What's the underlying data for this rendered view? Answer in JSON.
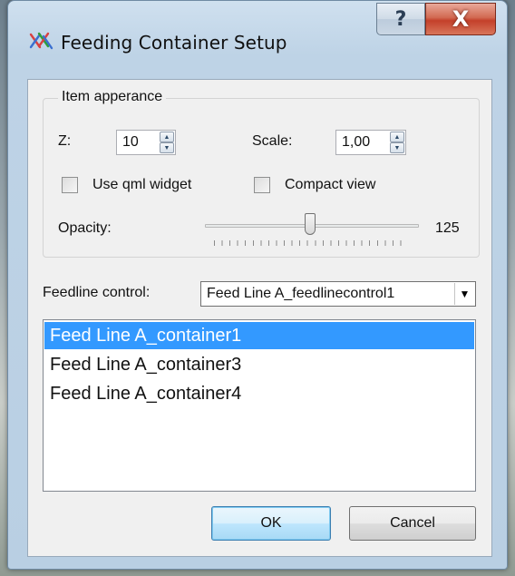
{
  "window": {
    "title": "Feeding Container Setup",
    "app_icon": "app-icon",
    "help_label": "?",
    "close_label": "X"
  },
  "item_appearance": {
    "group_title": "Item apperance",
    "z_label": "Z:",
    "z_value": "10",
    "scale_label": "Scale:",
    "scale_value": "1,00",
    "use_qml_label": "Use qml widget",
    "use_qml_checked": false,
    "compact_view_label": "Compact view",
    "compact_view_checked": false,
    "opacity_label": "Opacity:",
    "opacity_value": "125",
    "opacity_max": 255
  },
  "feedline": {
    "label": "Feedline control:",
    "selected": "Feed Line A_feedlinecontrol1"
  },
  "containers": {
    "items": [
      {
        "label": "Feed Line A_container1",
        "selected": true
      },
      {
        "label": "Feed Line A_container3",
        "selected": false
      },
      {
        "label": "Feed Line A_container4",
        "selected": false
      }
    ]
  },
  "buttons": {
    "ok": "OK",
    "cancel": "Cancel"
  },
  "colors": {
    "selection": "#3399ff",
    "close_button": "#c4402a"
  }
}
